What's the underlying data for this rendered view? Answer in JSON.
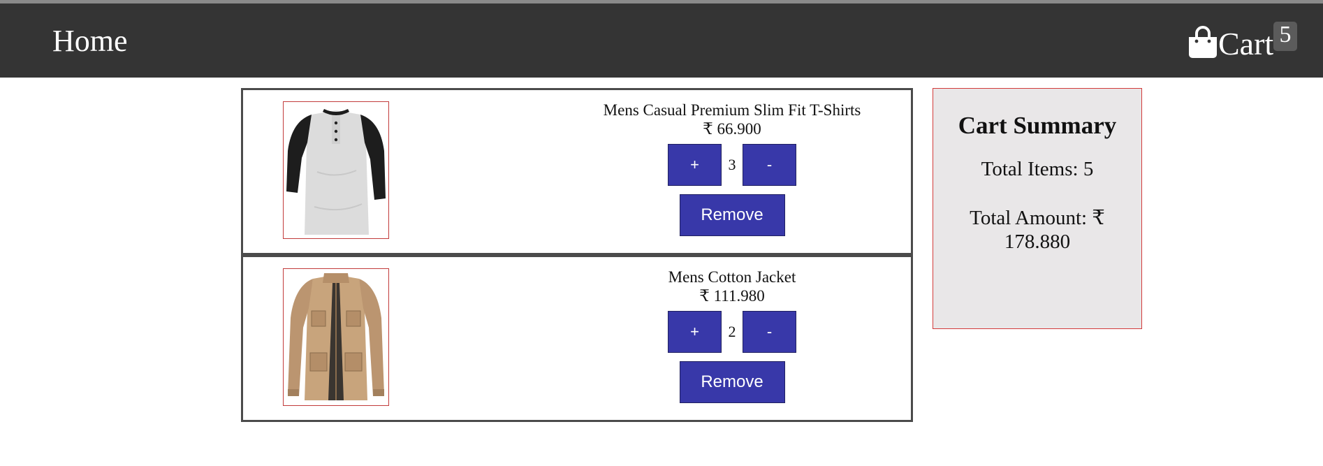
{
  "navbar": {
    "home_label": "Home",
    "cart_label": "Cart",
    "cart_count": "5"
  },
  "cart": {
    "items": [
      {
        "title": "Mens Casual Premium Slim Fit T-Shirts",
        "price": "₹ 66.900",
        "quantity": "3",
        "plus_label": "+",
        "minus_label": "-",
        "remove_label": "Remove"
      },
      {
        "title": "Mens Cotton Jacket",
        "price": "₹ 111.980",
        "quantity": "2",
        "plus_label": "+",
        "minus_label": "-",
        "remove_label": "Remove"
      }
    ]
  },
  "summary": {
    "title": "Cart Summary",
    "total_items": "Total Items: 5",
    "total_amount": "Total Amount: ₹ 178.880"
  },
  "colors": {
    "navbar_bg": "#343434",
    "button_bg": "#3838a9",
    "summary_bg": "#e9e7e8",
    "summary_border": "#d23a3a"
  },
  "icons": {
    "cart": "shopping-bag-icon",
    "product_1": "raglan-tshirt-image",
    "product_2": "cotton-jacket-image"
  }
}
